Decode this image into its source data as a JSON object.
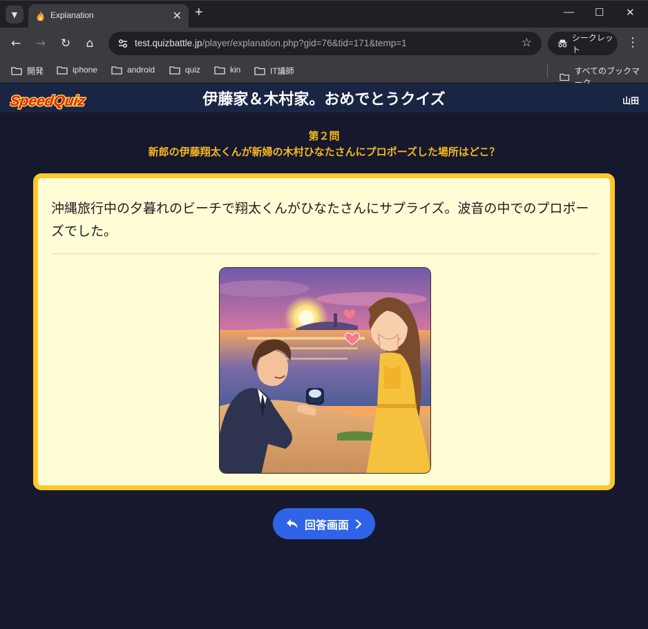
{
  "browser": {
    "tab_title": "Explanation",
    "tab_close": "✕",
    "new_tab": "+",
    "url_host": "test.quizbattle.jp",
    "url_path": "/player/explanation.php?gid=76&tid=171&temp=1",
    "incognito_label": "シークレット",
    "bookmarks": [
      "開発",
      "iphone",
      "android",
      "quiz",
      "kin",
      "IT議師"
    ],
    "all_bookmarks": "すべてのブックマーク"
  },
  "page": {
    "site_title": "伊藤家＆木村家。おめでとうクイズ",
    "user_name": "山田",
    "question_number": "第２問",
    "question_text": "新郎の伊藤翔太くんが新婦の木村ひなたさんにプロポーズした場所はどこ？",
    "explanation": "沖縄旅行中の夕暮れのビーチで翔太くんがひなたさんにサプライズ。波音の中でのプロポーズでした。",
    "answer_button": "回答画面"
  },
  "colors": {
    "page_bg": "#16182d",
    "accent_yellow": "#ffc72c",
    "question_text": "#f5b91f",
    "card_bg": "#fffcd6",
    "button_blue": "#2f63e8"
  }
}
